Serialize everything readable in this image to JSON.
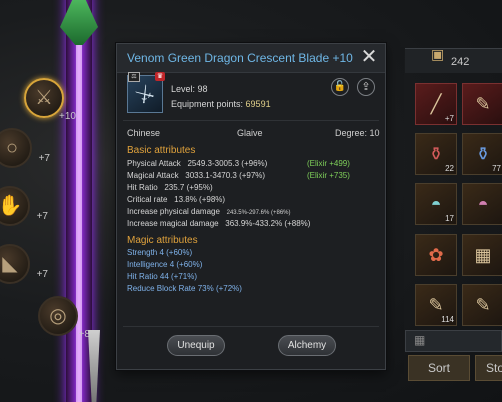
{
  "dialog": {
    "title": "Venom Green Dragon Crescent Blade +10",
    "close_icon": "close-icon",
    "level_label": "Level: 98",
    "equipment_points_label": "Equipment points: ",
    "equipment_points_value": "69591",
    "lock_icon": "lock-icon",
    "share_icon": "share-icon",
    "race": "Chinese",
    "weapon_type": "Glaive",
    "degree": "Degree: 10",
    "basic_title": "Basic attributes",
    "basic": [
      {
        "label": "Physical Attack",
        "value": "2549.3-3005.3 (+96%)",
        "elixir": "(Elixir +499)"
      },
      {
        "label": "Magical Attack",
        "value": "3033.1-3470.3 (+97%)",
        "elixir": "(Elixir +735)"
      },
      {
        "label": "Hit Ratio",
        "value": "235.7 (+95%)"
      },
      {
        "label": "Critical rate",
        "value": "13.8% (+98%)"
      },
      {
        "label": "Increase physical damage",
        "value": "243.5%-297.6% (+86%)"
      },
      {
        "label": "Increase magical damage",
        "value": "363.9%-433.2% (+88%)"
      }
    ],
    "magic_title": "Magic attributes",
    "magic": [
      "Strength  4 (+60%)",
      "Intelligence  4 (+60%)",
      "Hit Ratio  44 (+71%)",
      "Reduce Block Rate  73% (+72%)"
    ],
    "unequip_label": "Unequip",
    "alchemy_label": "Alchemy"
  },
  "equipment_slots": [
    {
      "icon": "sword-icon",
      "level": "+10"
    },
    {
      "icon": "ring-icon",
      "level": "+7"
    },
    {
      "icon": "glove-icon",
      "level": "+7"
    },
    {
      "icon": "boot-icon",
      "level": "+7"
    },
    {
      "icon": "ring-icon",
      "level": "+8"
    }
  ],
  "inventory": {
    "count": "242",
    "bag_icon": "bag-icon",
    "cells": [
      {
        "icon": "spear-icon",
        "count": "+7"
      },
      {
        "icon": "scroll-icon",
        "count": ""
      },
      {
        "icon": "potion-icon",
        "count": "22"
      },
      {
        "icon": "potion-icon",
        "count": "77"
      },
      {
        "icon": "helmet-icon",
        "count": "17"
      },
      {
        "icon": "helmet-icon",
        "count": ""
      },
      {
        "icon": "lotus-icon",
        "count": ""
      },
      {
        "icon": "box-icon",
        "count": ""
      },
      {
        "icon": "scroll-icon",
        "count": "114"
      },
      {
        "icon": "scroll-icon",
        "count": ""
      }
    ],
    "search_icon": "grid-icon",
    "sort_label": "Sort",
    "store_label": "Sto"
  }
}
